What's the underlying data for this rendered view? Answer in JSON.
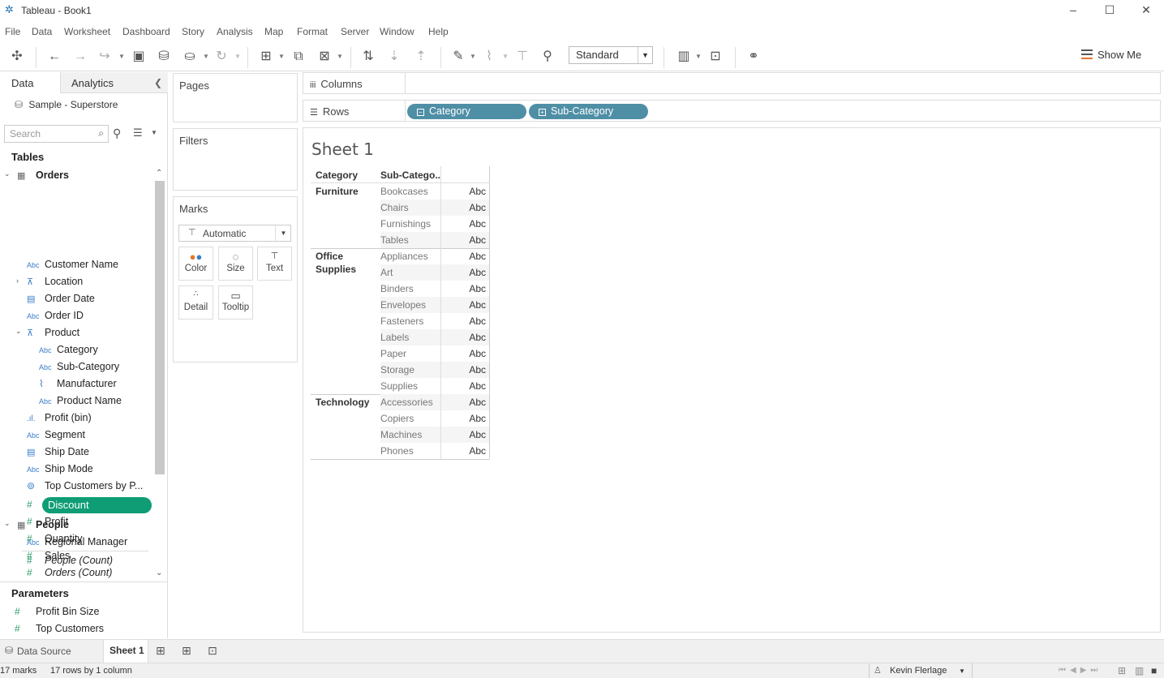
{
  "window": {
    "title": "Tableau - Book1",
    "controls": {
      "minimize": "–",
      "maximize": "☐",
      "close": "✕"
    }
  },
  "menu": [
    "File",
    "Data",
    "Worksheet",
    "Dashboard",
    "Story",
    "Analysis",
    "Map",
    "Format",
    "Server",
    "Window",
    "Help"
  ],
  "toolbar": {
    "fit_value": "Standard",
    "show_me": "Show Me"
  },
  "left_pane": {
    "tabs": {
      "data": "Data",
      "analytics": "Analytics"
    },
    "datasource": "Sample - Superstore",
    "search_placeholder": "Search",
    "tables_heading": "Tables",
    "orders_table": "Orders",
    "orders_fields": [
      {
        "type": "Abc",
        "name": "Customer Name"
      },
      {
        "type": "hier",
        "name": "Location"
      },
      {
        "type": "date",
        "name": "Order Date"
      },
      {
        "type": "Abc",
        "name": "Order ID"
      },
      {
        "type": "hier",
        "name": "Product"
      },
      {
        "type": "Abc",
        "name": "Category"
      },
      {
        "type": "Abc",
        "name": "Sub-Category"
      },
      {
        "type": "clip",
        "name": "Manufacturer"
      },
      {
        "type": "Abc",
        "name": "Product Name"
      },
      {
        "type": "bin",
        "name": "Profit (bin)"
      },
      {
        "type": "Abc",
        "name": "Segment"
      },
      {
        "type": "date",
        "name": "Ship Date"
      },
      {
        "type": "Abc",
        "name": "Ship Mode"
      },
      {
        "type": "set",
        "name": "Top Customers by P..."
      },
      {
        "type": "#",
        "name": "Discount"
      },
      {
        "type": "#",
        "name": "Profit"
      },
      {
        "type": "#",
        "name": "Quantity"
      },
      {
        "type": "#",
        "name": "Sales"
      },
      {
        "type": "#",
        "name": "Orders (Count)"
      }
    ],
    "people_table": "People",
    "people_fields": [
      {
        "type": "Abc",
        "name": "Regional Manager"
      },
      {
        "type": "#",
        "name": "People (Count)"
      }
    ],
    "parameters_heading": "Parameters",
    "parameters": [
      {
        "type": "#",
        "name": "Profit Bin Size"
      },
      {
        "type": "#",
        "name": "Top Customers"
      }
    ]
  },
  "cards": {
    "pages": "Pages",
    "filters": "Filters",
    "marks": "Marks",
    "marks_type": "Automatic",
    "mark_buttons": [
      "Color",
      "Size",
      "Text",
      "Detail",
      "Tooltip"
    ]
  },
  "shelves": {
    "columns": "Columns",
    "rows": "Rows",
    "row_pills": [
      "Category",
      "Sub-Category"
    ]
  },
  "view": {
    "sheet_title": "Sheet 1",
    "headers": {
      "category": "Category",
      "subcategory": "Sub-Catego.."
    },
    "groups": [
      {
        "category": "Furniture",
        "subs": [
          "Bookcases",
          "Chairs",
          "Furnishings",
          "Tables"
        ]
      },
      {
        "category": "Office Supplies",
        "subs": [
          "Appliances",
          "Art",
          "Binders",
          "Envelopes",
          "Fasteners",
          "Labels",
          "Paper",
          "Storage",
          "Supplies"
        ]
      },
      {
        "category": "Technology",
        "subs": [
          "Accessories",
          "Copiers",
          "Machines",
          "Phones"
        ]
      }
    ],
    "cell_value": "Abc"
  },
  "bottom_tabs": {
    "data_source": "Data Source",
    "sheet": "Sheet 1"
  },
  "status": {
    "marks": "17 marks",
    "dims": "17 rows by 1 column",
    "user": "Kevin Flerlage"
  }
}
